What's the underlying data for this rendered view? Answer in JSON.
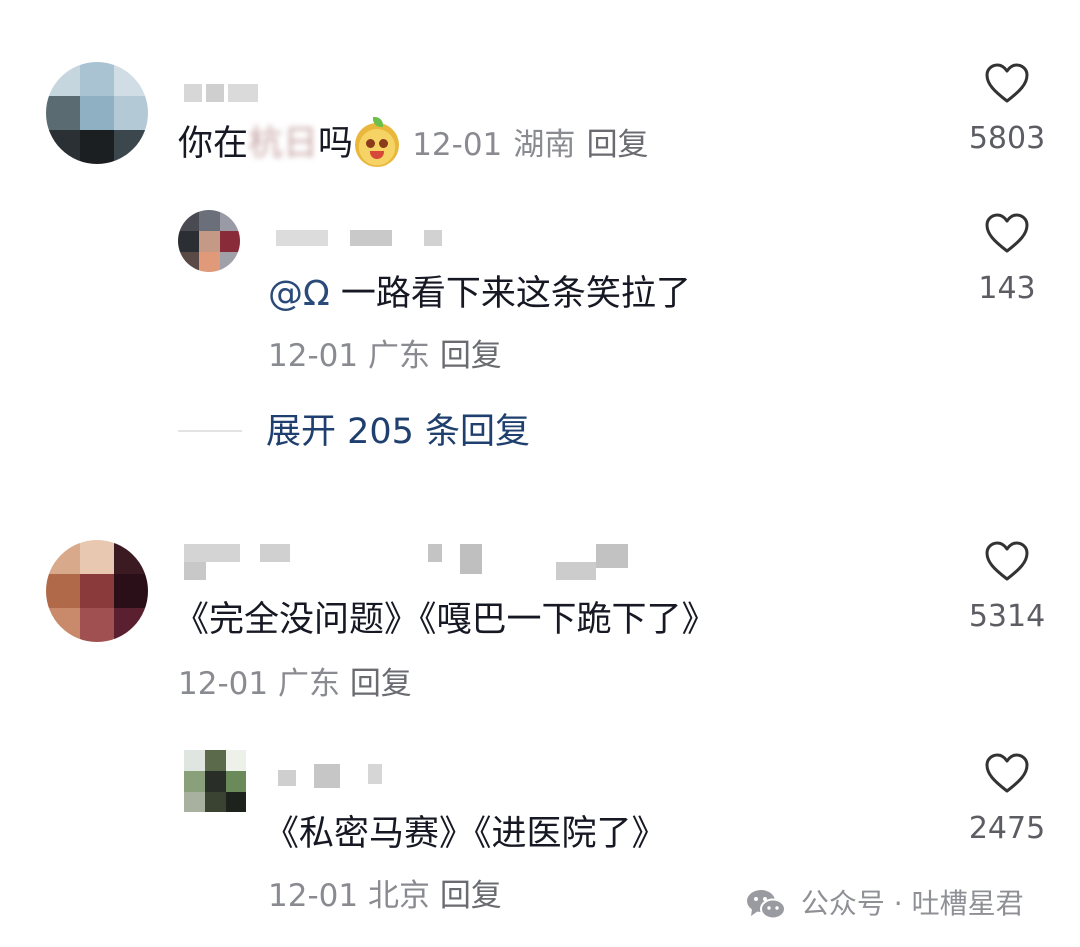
{
  "comments": [
    {
      "text_prefix": "你在",
      "text_blurred": "杭日",
      "text_suffix": "吗",
      "emoji_icon": "smiling-mascot-emoji",
      "date": "12-01",
      "location": "湖南",
      "reply_label": "回复",
      "likes": "5803",
      "replies": [
        {
          "mention": "@Ω",
          "text": " 一路看下来这条笑拉了",
          "date": "12-01",
          "location": "广东",
          "reply_label": "回复",
          "likes": "143"
        }
      ],
      "expand_label": "展开 205 条回复"
    },
    {
      "text": "《完全没问题》《嘎巴一下跪下了》",
      "date": "12-01",
      "location": "广东",
      "reply_label": "回复",
      "likes": "5314",
      "replies": [
        {
          "text": "《私密马赛》《进医院了》",
          "date": "12-01",
          "location": "北京",
          "reply_label": "回复",
          "likes": "2475"
        }
      ]
    }
  ],
  "watermark": {
    "icon": "wechat-icon",
    "text": "公众号 · 吐槽星君"
  }
}
